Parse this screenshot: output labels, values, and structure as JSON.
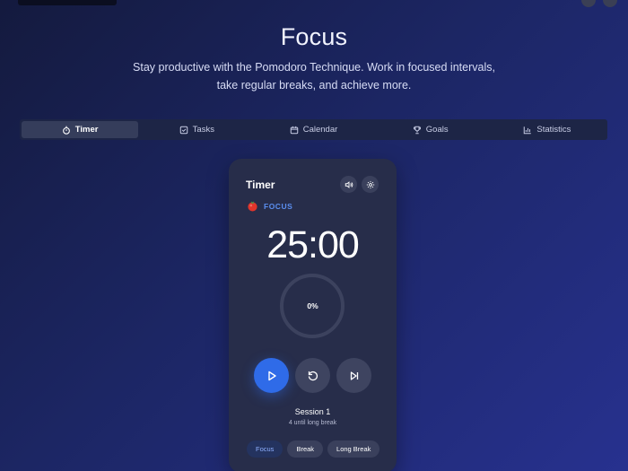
{
  "header": {
    "title": "Focus",
    "subtitle": "Stay productive with the Pomodoro Technique. Work in focused intervals, take regular breaks, and achieve more."
  },
  "tabs": [
    {
      "label": "Timer",
      "icon": "stopwatch-icon",
      "active": true
    },
    {
      "label": "Tasks",
      "icon": "checkbox-icon",
      "active": false
    },
    {
      "label": "Calendar",
      "icon": "calendar-icon",
      "active": false
    },
    {
      "label": "Goals",
      "icon": "trophy-icon",
      "active": false
    },
    {
      "label": "Statistics",
      "icon": "bar-chart-icon",
      "active": false
    }
  ],
  "timer": {
    "title": "Timer",
    "mode_label": "FOCUS",
    "time": "25:00",
    "progress_text": "0%",
    "progress": 0,
    "session_label": "Session 1",
    "until_break": "4 until long break",
    "mode_buttons": [
      "Focus",
      "Break",
      "Long Break"
    ],
    "active_mode": "Focus"
  },
  "colors": {
    "accent": "#2f6be8",
    "mode_label": "#5b8ff0",
    "card": "#272d4a"
  }
}
